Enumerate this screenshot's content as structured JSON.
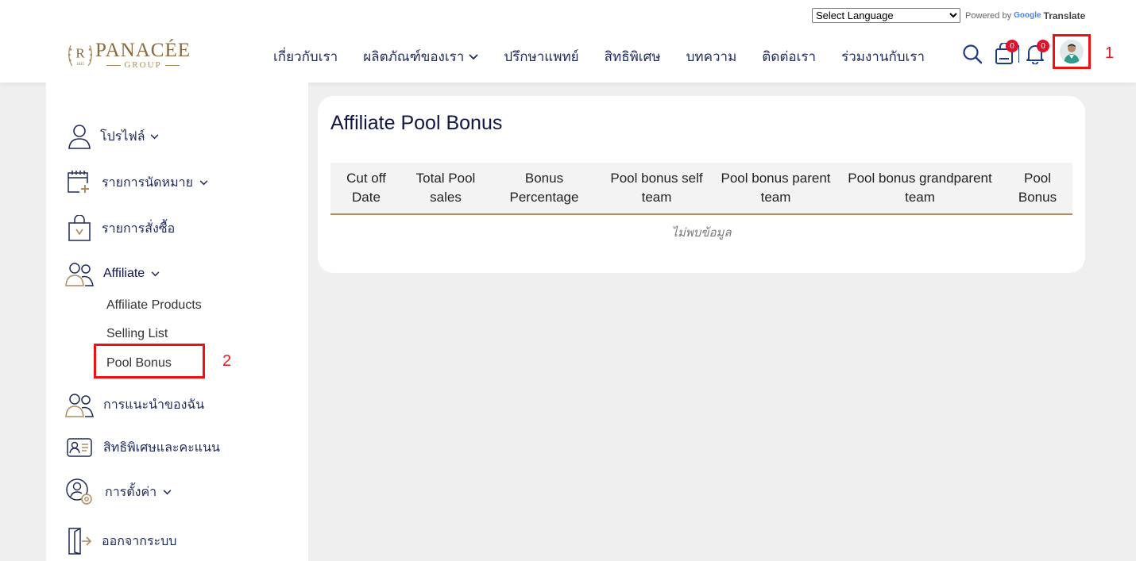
{
  "header": {
    "translate": {
      "select_label": "Select Language",
      "powered_by": "Powered by",
      "google": "Google",
      "translate": "Translate"
    },
    "logo": {
      "name": "PANACÉE",
      "sub": "GROUP"
    },
    "nav": [
      {
        "label": "เกี่ยวกับเรา",
        "has_dropdown": false
      },
      {
        "label": "ผลิตภัณฑ์ของเรา",
        "has_dropdown": true
      },
      {
        "label": "ปรึกษาแพทย์",
        "has_dropdown": false
      },
      {
        "label": "สิทธิพิเศษ",
        "has_dropdown": false
      },
      {
        "label": "บทความ",
        "has_dropdown": false
      },
      {
        "label": "ติดต่อเรา",
        "has_dropdown": false
      },
      {
        "label": "ร่วมงานกับเรา",
        "has_dropdown": false
      }
    ],
    "cart_count": "0",
    "notification_count": "0",
    "annotation_1": "1",
    "annotation_2": "2"
  },
  "sidebar": {
    "profile": "โปรไฟล์",
    "appointments": "รายการนัดหมาย",
    "orders": "รายการสั่งซื้อ",
    "affiliate": "Affiliate",
    "affiliate_products": "Affiliate Products",
    "selling_list": "Selling List",
    "pool_bonus": "Pool Bonus",
    "referrals": "การแนะนำของฉัน",
    "privileges": "สิทธิพิเศษและคะแนน",
    "settings": "การตั้งค่า",
    "logout": "ออกจากระบบ"
  },
  "main": {
    "title": "Affiliate Pool Bonus",
    "columns": [
      "Cut off Date",
      "Total Pool sales",
      "Bonus Percentage",
      "Pool bonus self team",
      "Pool bonus parent team",
      "Pool bonus grandparent team",
      "Pool Bonus"
    ],
    "empty_text": "ไม่พบข้อมูล"
  },
  "colors": {
    "accent": "#1e2a5a",
    "brand_gold": "#8a6a3c",
    "badge": "#e0102b",
    "annotation": "#ee1111"
  }
}
